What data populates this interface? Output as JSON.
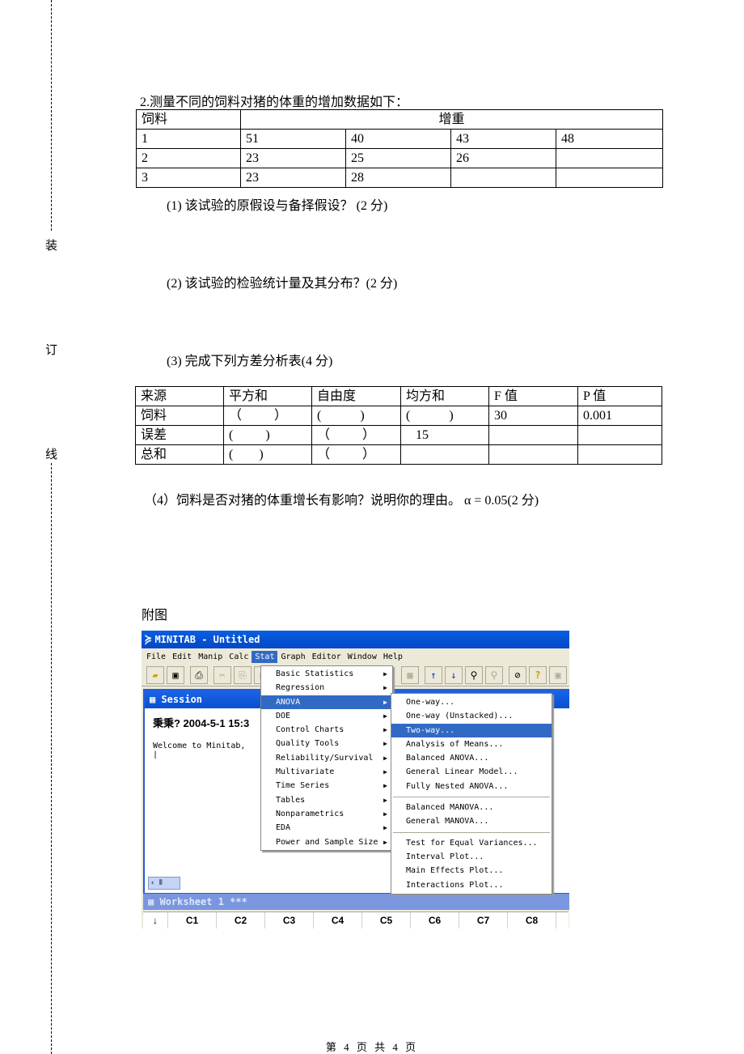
{
  "binding_margin": {
    "chars": [
      "装",
      "订",
      "线"
    ]
  },
  "question": {
    "title": "2.测量不同的饲料对猪的体重的增加数据如下：",
    "data_table": {
      "header": {
        "col1": "饲料",
        "col2": "增重"
      },
      "rows": [
        {
          "feed": "1",
          "values": [
            "51",
            "40",
            "43",
            "48"
          ]
        },
        {
          "feed": "2",
          "values": [
            "23",
            "25",
            "26",
            ""
          ]
        },
        {
          "feed": "3",
          "values": [
            "23",
            "28",
            "",
            ""
          ]
        }
      ]
    },
    "sub_questions": [
      "(1)  该试验的原假设与备择假设？  (2 分)",
      "(2)  该试验的检验统计量及其分布？(2 分)",
      "(3)  完成下列方差分析表(4 分)",
      "（4）饲料是否对猪的体重增长有影响？说明你的理由。 α = 0.05(2 分)"
    ],
    "anova_table": {
      "headers": [
        "来源",
        "平方和",
        "自由度",
        "均方和",
        "F 值",
        "P 值"
      ],
      "rows": [
        [
          "饲料",
          "（          ）",
          "(            )",
          "(            )",
          "30",
          "0.001"
        ],
        [
          "误差",
          "(          )",
          "（          ）",
          "   15",
          "",
          ""
        ],
        [
          "总和",
          "(        )",
          "（          ）",
          "",
          "",
          ""
        ]
      ]
    }
  },
  "figure": {
    "label": "附图",
    "minitab": {
      "window_title": "MINITAB - Untitled",
      "menubar": [
        "File",
        "Edit",
        "Manip",
        "Calc",
        "Stat",
        "Graph",
        "Editor",
        "Window",
        "Help"
      ],
      "active_menu": "Stat",
      "toolbar_icons": [
        "open-icon",
        "save-icon",
        "print-icon",
        "cut-icon",
        "copy-icon",
        "paste-icon",
        "edit-icon",
        "up-arrow-icon",
        "down-arrow-icon",
        "find-icon",
        "replace-icon",
        "cancel-icon",
        "help-icon",
        "window-icon"
      ],
      "session": {
        "title": "Session",
        "date_line": "秉秉? 2004-5-1 15:3",
        "welcome": "Welcome to Minitab,"
      },
      "stat_menu": [
        {
          "label": "Basic Statistics",
          "submenu": true
        },
        {
          "label": "Regression",
          "submenu": true
        },
        {
          "label": "ANOVA",
          "submenu": true,
          "highlighted": true
        },
        {
          "label": "DOE",
          "submenu": true
        },
        {
          "label": "Control Charts",
          "submenu": true
        },
        {
          "label": "Quality Tools",
          "submenu": true
        },
        {
          "label": "Reliability/Survival",
          "submenu": true
        },
        {
          "label": "Multivariate",
          "submenu": true
        },
        {
          "label": "Time Series",
          "submenu": true
        },
        {
          "label": "Tables",
          "submenu": true
        },
        {
          "label": "Nonparametrics",
          "submenu": true
        },
        {
          "label": "EDA",
          "submenu": true
        },
        {
          "label": "Power and Sample Size",
          "submenu": true
        }
      ],
      "anova_menu": {
        "group1": [
          "One-way...",
          "One-way (Unstacked)...",
          "Two-way...",
          "Analysis of Means...",
          "Balanced ANOVA...",
          "General Linear Model...",
          "Fully Nested ANOVA..."
        ],
        "group2": [
          "Balanced MANOVA...",
          "General MANOVA..."
        ],
        "group3": [
          "Test for Equal Variances...",
          "Interval Plot...",
          "Main Effects Plot...",
          "Interactions Plot..."
        ],
        "highlighted": "Two-way..."
      },
      "worksheet": {
        "title": "Worksheet 1 ***",
        "row_marker": "↓",
        "columns": [
          "C1",
          "C2",
          "C3",
          "C4",
          "C5",
          "C6",
          "C7",
          "C8"
        ]
      }
    }
  },
  "footer": {
    "page": "第 4 页 共 4 页"
  }
}
